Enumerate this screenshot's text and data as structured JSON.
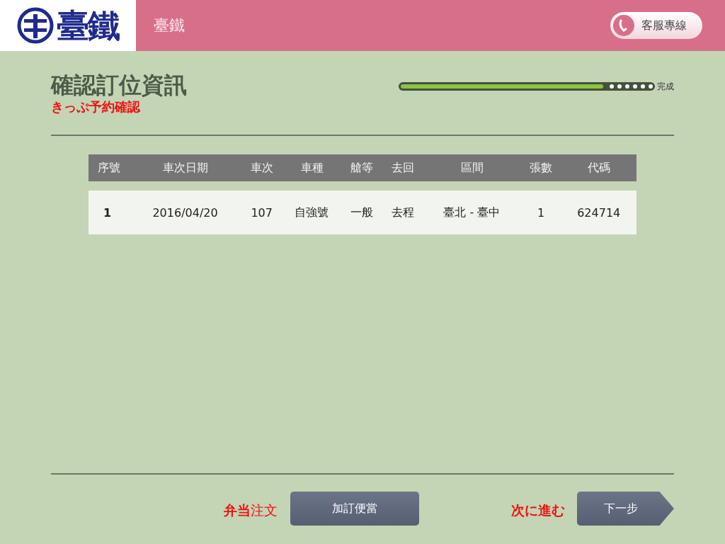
{
  "header": {
    "logo_text": "臺鐵",
    "title": "臺鐵",
    "hotline_button": "客服專線"
  },
  "page": {
    "title": "確認訂位資訊",
    "subtitle": "きっぷ予約確認"
  },
  "progress": {
    "level": 0.8,
    "label": "完成"
  },
  "table": {
    "columns": [
      "序號",
      "車次日期",
      "車次",
      "車種",
      "艙等",
      "去回",
      "區間",
      "張數",
      "代碼"
    ],
    "rows": [
      [
        "1",
        "2016/04/20",
        "107",
        "自強號",
        "一般",
        "去程",
        "臺北 - 臺中",
        "1",
        "624714"
      ]
    ]
  },
  "footer": {
    "bento_label": "**弁当**注文",
    "bento_button": "加訂便當",
    "next_label": "次に進む",
    "next_button": "下一步"
  }
}
